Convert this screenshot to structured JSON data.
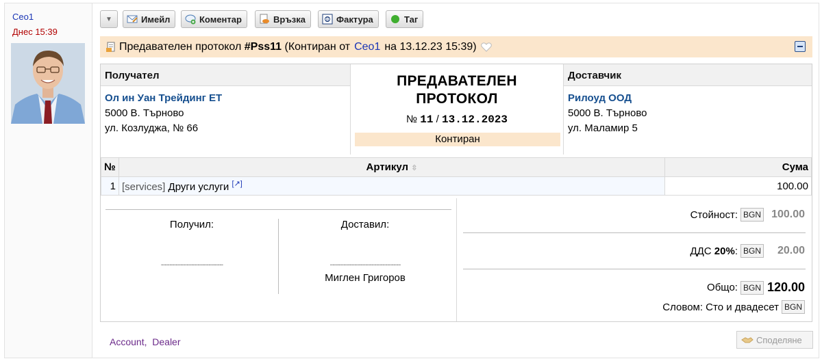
{
  "post": {
    "author": "Ceo1",
    "date": "Днес 15:39"
  },
  "toolbar": {
    "email": "Имейл",
    "comment": "Коментар",
    "link": "Връзка",
    "invoice": "Фактура",
    "tag": "Таг"
  },
  "header": {
    "prefix": "Предавателен протокол",
    "number": "#Pss11",
    "contir_open": "(Контиран от",
    "user": "Ceo1",
    "contir_close": "на 13.12.23 15:39)"
  },
  "recipient": {
    "title": "Получател",
    "name": "Ол ин Уан Трейдинг ЕТ",
    "city": "5000 В. Търново",
    "street": "ул. Козлуджа, № 66"
  },
  "supplier": {
    "title": "Доставчик",
    "name": "Рилоуд ООД",
    "city": "5000 В. Търново",
    "street": "ул. Маламир 5"
  },
  "doc": {
    "type_line1": "ПРЕДАВАТЕЛЕН",
    "type_line2": "ПРОТОКОЛ",
    "num_prefix": "№",
    "number": "11",
    "sep": "/",
    "date": "13.12.2023",
    "status": "Контиран"
  },
  "items": {
    "col_no": "№",
    "col_article": "Артикул",
    "col_sum": "Сума",
    "rows": [
      {
        "no": "1",
        "code": "[services]",
        "name": "Други услуги",
        "sum": "100.00"
      }
    ]
  },
  "signatures": {
    "received": "Получил:",
    "delivered": "Доставил:",
    "dots_left": "...................................................",
    "dots_right": "..........................................................",
    "delivered_name": "Миглен Григоров"
  },
  "totals": {
    "value_label": "Стойност:",
    "currency": "BGN",
    "value": "100.00",
    "vat_label": "ДДС",
    "vat_rate": "20%",
    "vat_colon": ":",
    "vat": "20.00",
    "total_label": "Общо:",
    "total": "120.00",
    "words_label": "Словом: Сто и двадесет"
  },
  "footer": {
    "link1": "Account",
    "link2": "Dealer",
    "share": "Споделяне"
  }
}
